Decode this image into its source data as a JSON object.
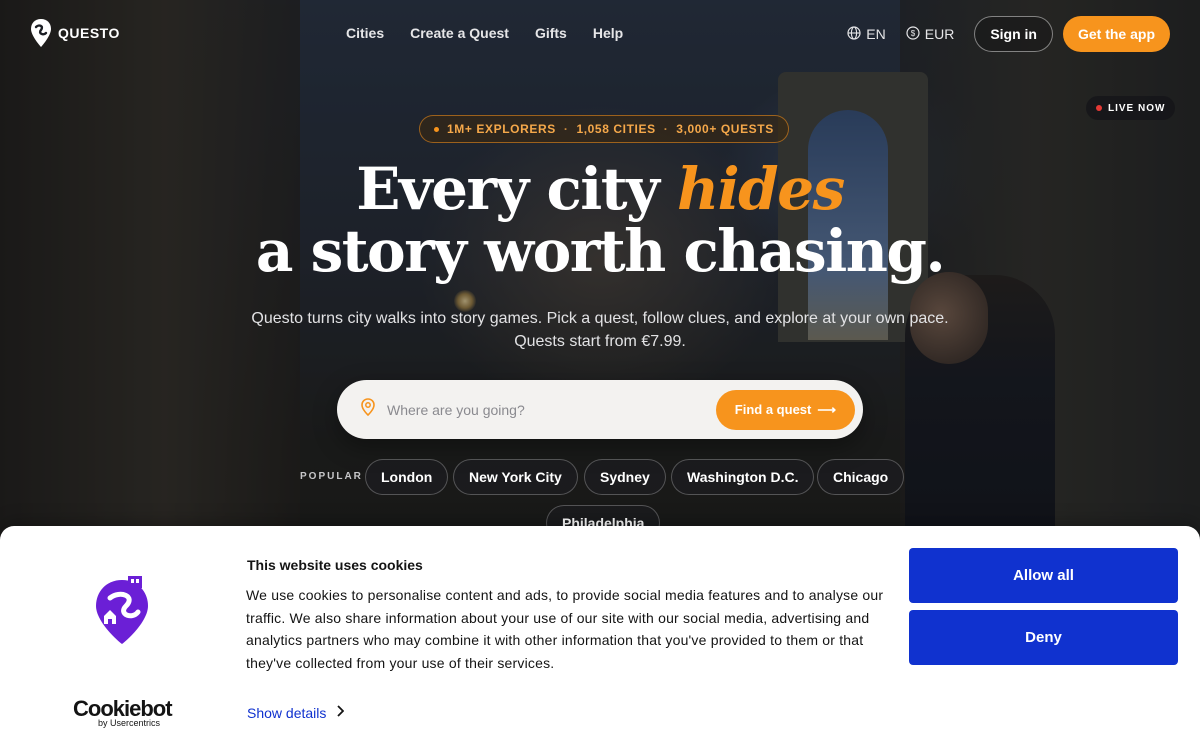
{
  "brand": {
    "name": "QUESTO"
  },
  "nav": {
    "links": [
      "Cities",
      "Create a Quest",
      "Gifts",
      "Help"
    ],
    "language": "EN",
    "currency": "EUR",
    "signin_label": "Sign in",
    "app_label": "Get the app"
  },
  "live_badge": "LIVE NOW",
  "hero": {
    "stats": [
      "1M+ EXPLORERS",
      "1,058 CITIES",
      "3,000+ QUESTS"
    ],
    "stats_separator": "·",
    "headline_part1": "Every city ",
    "headline_highlight": "hides",
    "headline_line2": "a story worth chasing.",
    "subtitle": "Questo turns city walks into story games. Pick a quest, follow clues, and explore at your own pace. Quests start from €7.99."
  },
  "search": {
    "placeholder": "Where are you going?",
    "button_label": "Find a quest",
    "button_arrow": "⟶"
  },
  "popular": {
    "label": "POPULAR",
    "cities": [
      "London",
      "New York City",
      "Sydney",
      "Washington D.C.",
      "Chicago",
      "Philadelphia"
    ]
  },
  "cookie_banner": {
    "title": "This website uses cookies",
    "body": "We use cookies to personalise content and ads, to provide social media features and to analyse our traffic. We also share information about your use of our site with our social media, advertising and analytics partners who may combine it with other information that you've provided to them or that they've collected from your use of their services.",
    "show_details": "Show details",
    "allow_all": "Allow all",
    "deny": "Deny",
    "provider": "Cookiebot",
    "provider_sub": "by Usercentrics"
  },
  "colors": {
    "accent": "#f7941d",
    "cookie_button": "#1032cf",
    "cookie_logo": "#6b1fd6"
  },
  "icons": [
    "questo-logo-icon",
    "globe-icon",
    "currency-icon",
    "location-pin-icon",
    "arrow-right-icon",
    "chevron-right-icon",
    "cookie-logo-icon"
  ]
}
